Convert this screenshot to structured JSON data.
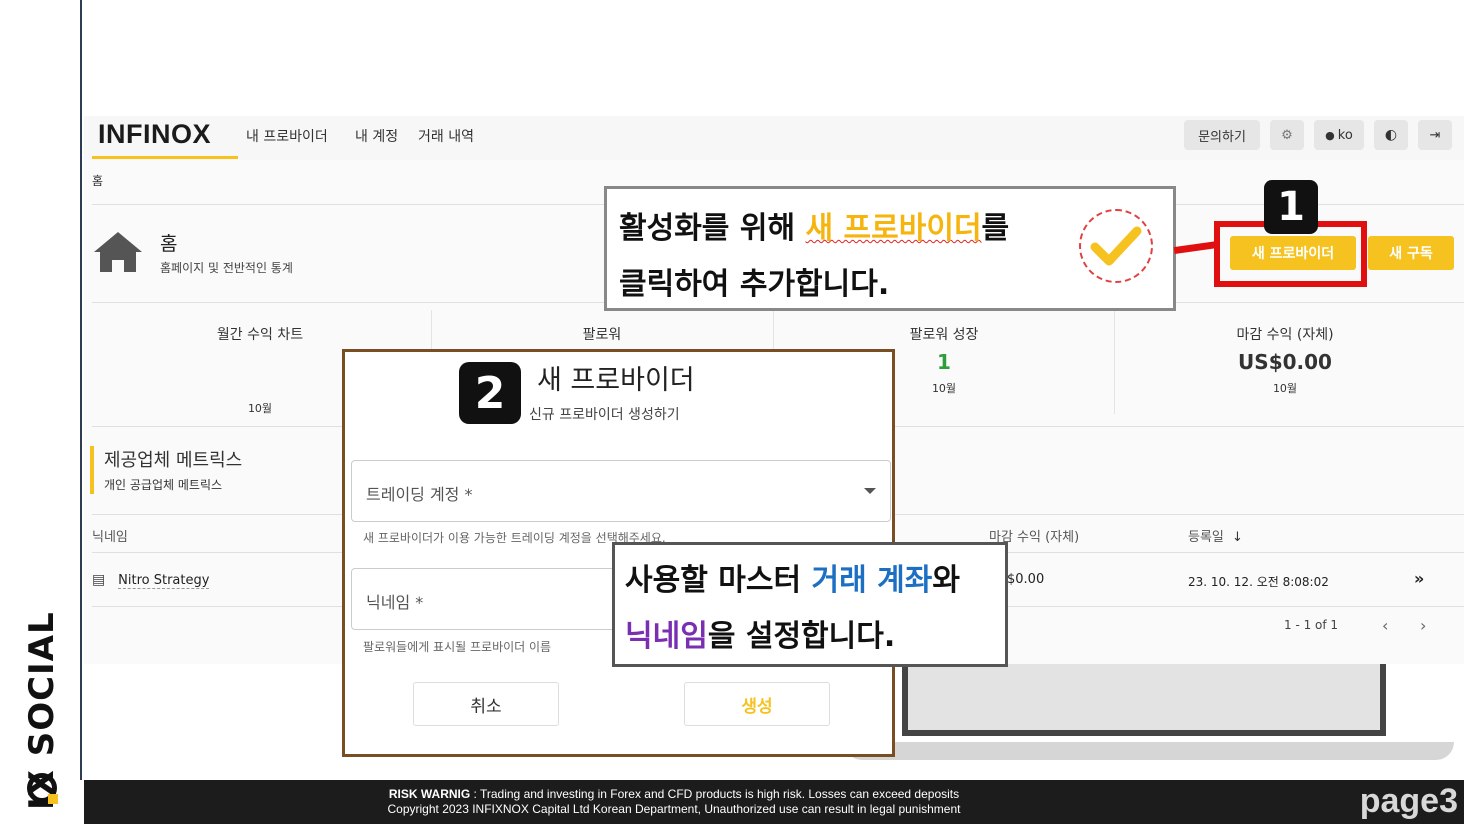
{
  "sidebar": {
    "brand": "IX SOCIAL"
  },
  "nav": {
    "logo": "INFINOX",
    "links": [
      "내 프로바이더",
      "내 계정",
      "거래 내역"
    ],
    "contact_label": "문의하기",
    "lang_label": "ko"
  },
  "breadcrumb": "홈",
  "page": {
    "title": "홈",
    "subtitle": "홈페이지 및 전반적인 통계",
    "new_provider_label": "새 프로바이더",
    "new_subscription_label": "새 구독"
  },
  "stats": [
    {
      "label": "월간 수익 차트",
      "value": "",
      "period": "10월"
    },
    {
      "label": "팔로워",
      "value": "",
      "period": ""
    },
    {
      "label": "팔로워 성장",
      "value": "1",
      "period": "10월"
    },
    {
      "label": "마감 수익 (자체)",
      "value": "US$0.00",
      "period": "10월"
    }
  ],
  "metrics": {
    "title": "제공업체 메트릭스",
    "subtitle": "개인 공급업체 메트릭스",
    "columns": {
      "nickname": "닉네임",
      "closed_profit": "마감 수익 (자체)",
      "registered": "등록일"
    },
    "rows": [
      {
        "nickname": "Nitro Strategy",
        "closed_profit": "$0.00",
        "registered": "23. 10. 12. 오전 8:08:02"
      }
    ],
    "pagination": "1 - 1 of 1"
  },
  "modal": {
    "badge": "2",
    "title": "새 프로바이더",
    "subtitle": "신규 프로바이더 생성하기",
    "trading_account_label": "트레이딩 계정 *",
    "trading_account_help": "새 프로바이더가 이용 가능한 트레이딩 계정을 선택해주세요.",
    "nickname_label": "닉네임 *",
    "nickname_help": "팔로워들에게 표시될 프로바이더 이름",
    "cancel_label": "취소",
    "create_label": "생성"
  },
  "callout1": {
    "badge": "1",
    "line1_a": "활성화를 위해 ",
    "line1_hl": "새 프로바이더",
    "line1_b": "를",
    "line2": "클릭하여 추가합니다."
  },
  "callout2": {
    "line1_a": "사용할 마스터 ",
    "line1_hl": "거래 계좌",
    "line1_b": "와",
    "line2_hl": "닉네임",
    "line2_b": "을 설정합니다."
  },
  "footer": {
    "warning_title": "RISK WARNIG",
    "warning_text": " : Trading and investing in Forex and CFD products is high risk. Losses can exceed deposits",
    "copyright": "Copyright 2023 INFIXNOX Capital Ltd Korean Department, Unauthorized use can result in legal punishment",
    "page_tag": "page3"
  },
  "colors": {
    "accent": "#f6c220",
    "callout_red": "#e01010",
    "highlight_blue": "#1d6fc4",
    "highlight_purple": "#7a2fb3"
  }
}
